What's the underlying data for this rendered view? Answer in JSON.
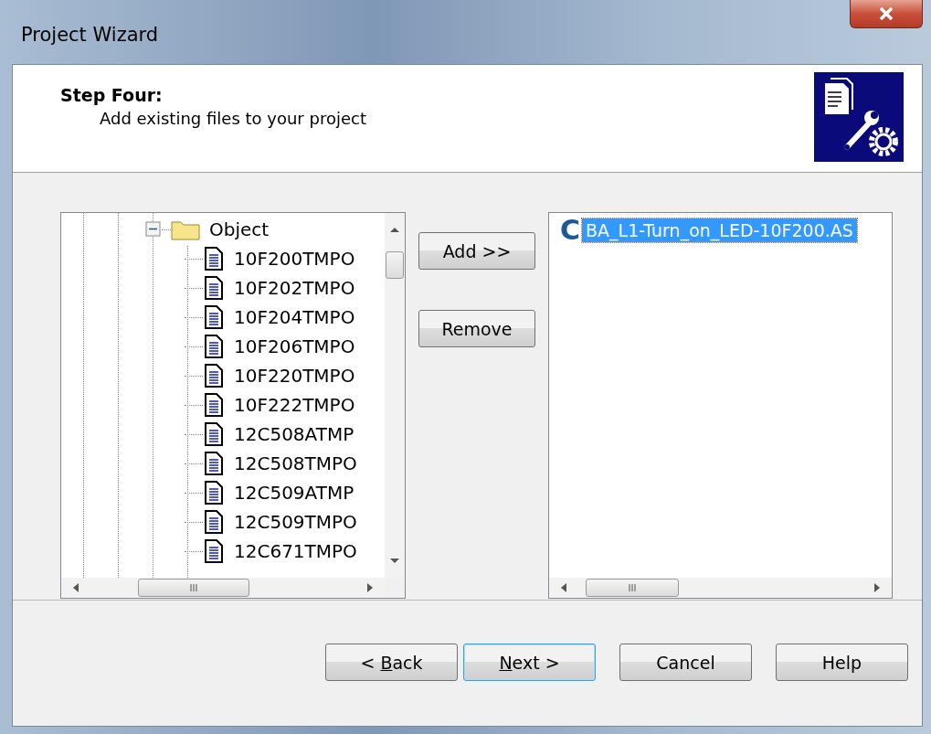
{
  "window": {
    "title": "Project Wizard"
  },
  "header": {
    "step": "Step Four:",
    "description": "Add existing files to your project"
  },
  "tree": [
    {
      "label": "Object",
      "expanded": true,
      "children": [
        {
          "label": "10F200TMPO"
        },
        {
          "label": "10F202TMPO"
        },
        {
          "label": "10F204TMPO"
        },
        {
          "label": "10F206TMPO"
        },
        {
          "label": "10F220TMPO"
        },
        {
          "label": "10F222TMPO"
        },
        {
          "label": "12C508ATMP"
        },
        {
          "label": "12C508TMPO"
        },
        {
          "label": "12C509ATMP"
        },
        {
          "label": "12C509TMPO"
        },
        {
          "label": "12C671TMPO"
        }
      ]
    }
  ],
  "transfer_buttons": [
    "Add >>",
    "Remove"
  ],
  "project_files": [
    {
      "letter": "C",
      "label": "BA_L1-Turn_on_LED-10F200.AS",
      "selected": true
    }
  ],
  "footer_buttons": [
    {
      "before": "< ",
      "key": "B",
      "after": "ack",
      "focused": false
    },
    {
      "key": "N",
      "after": "ext >",
      "focused": true
    },
    {
      "before": "Cancel",
      "focused": false
    },
    {
      "before": "Help",
      "focused": false
    }
  ]
}
